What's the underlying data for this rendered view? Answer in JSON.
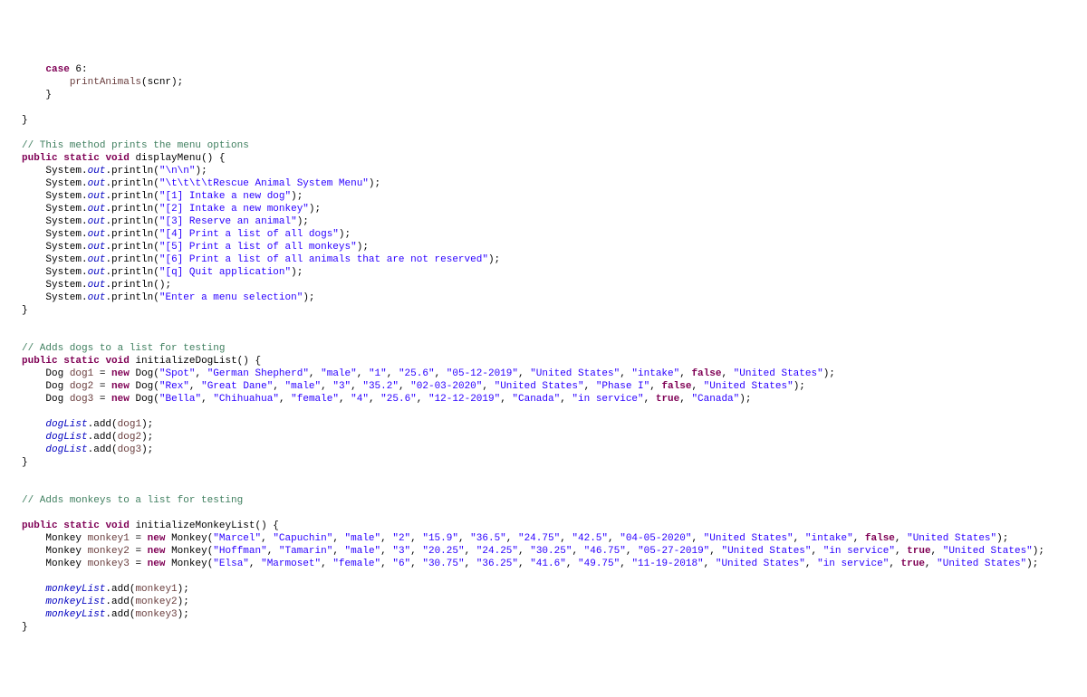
{
  "lines": {
    "l0a": "case",
    "l0b": "6",
    "l0c": ":",
    "l1a": "printAnimals(scnr);",
    "l2a": "}",
    "l4a": "}",
    "cmMenu": "// This method prints the menu options",
    "kwPublic": "public",
    "kwStatic": "static",
    "kwVoid": "void",
    "kwNew": "new",
    "kwFalse": "false",
    "kwTrue": "true",
    "mDisplayMenu": "displayMenu",
    "mInitDog": "initializeDogList",
    "mInitMonkey": "initializeMonkeyList",
    "sys": "System",
    "out": "out",
    "println": "println",
    "s_nn": "\"\\n\\n\"",
    "s_title": "\"\\t\\t\\t\\tRescue Animal System Menu\"",
    "s_1": "\"[1] Intake a new dog\"",
    "s_2": "\"[2] Intake a new monkey\"",
    "s_3": "\"[3] Reserve an animal\"",
    "s_4": "\"[4] Print a list of all dogs\"",
    "s_5": "\"[5] Print a list of all monkeys\"",
    "s_6": "\"[6] Print a list of all animals that are not reserved\"",
    "s_q": "\"[q] Quit application\"",
    "s_enter": "\"Enter a menu selection\"",
    "cmDogs": "// Adds dogs to a list for testing",
    "cmMonkeys": "// Adds monkeys to a list for testing",
    "tDog": "Dog",
    "tMonkey": "Monkey",
    "vDog1": "dog1",
    "vDog2": "dog2",
    "vDog3": "dog3",
    "vMon1": "monkey1",
    "vMon2": "monkey2",
    "vMon3": "monkey3",
    "fDogList": "dogList",
    "fMonkeyList": "monkeyList",
    "mAdd": "add",
    "d1": [
      "\"Spot\"",
      "\"German Shepherd\"",
      "\"male\"",
      "\"1\"",
      "\"25.6\"",
      "\"05-12-2019\"",
      "\"United States\"",
      "\"intake\"",
      "\"United States\""
    ],
    "d2": [
      "\"Rex\"",
      "\"Great Dane\"",
      "\"male\"",
      "\"3\"",
      "\"35.2\"",
      "\"02-03-2020\"",
      "\"United States\"",
      "\"Phase I\"",
      "\"United States\""
    ],
    "d3": [
      "\"Bella\"",
      "\"Chihuahua\"",
      "\"female\"",
      "\"4\"",
      "\"25.6\"",
      "\"12-12-2019\"",
      "\"Canada\"",
      "\"in service\"",
      "\"Canada\""
    ],
    "m1": [
      "\"Marcel\"",
      "\"Capuchin\"",
      "\"male\"",
      "\"2\"",
      "\"15.9\"",
      "\"36.5\"",
      "\"24.75\"",
      "\"42.5\"",
      "\"04-05-2020\"",
      "\"United States\"",
      "\"intake\"",
      "\"United States\""
    ],
    "m2": [
      "\"Hoffman\"",
      "\"Tamarin\"",
      "\"male\"",
      "\"3\"",
      "\"20.25\"",
      "\"24.25\"",
      "\"30.25\"",
      "\"46.75\"",
      "\"05-27-2019\"",
      "\"United States\"",
      "\"in service\"",
      "\"United States\""
    ],
    "m3": [
      "\"Elsa\"",
      "\"Marmoset\"",
      "\"female\"",
      "\"6\"",
      "\"30.75\"",
      "\"36.25\"",
      "\"41.6\"",
      "\"49.75\"",
      "\"11-19-2018\"",
      "\"United States\"",
      "\"in service\"",
      "\"United States\""
    ]
  }
}
